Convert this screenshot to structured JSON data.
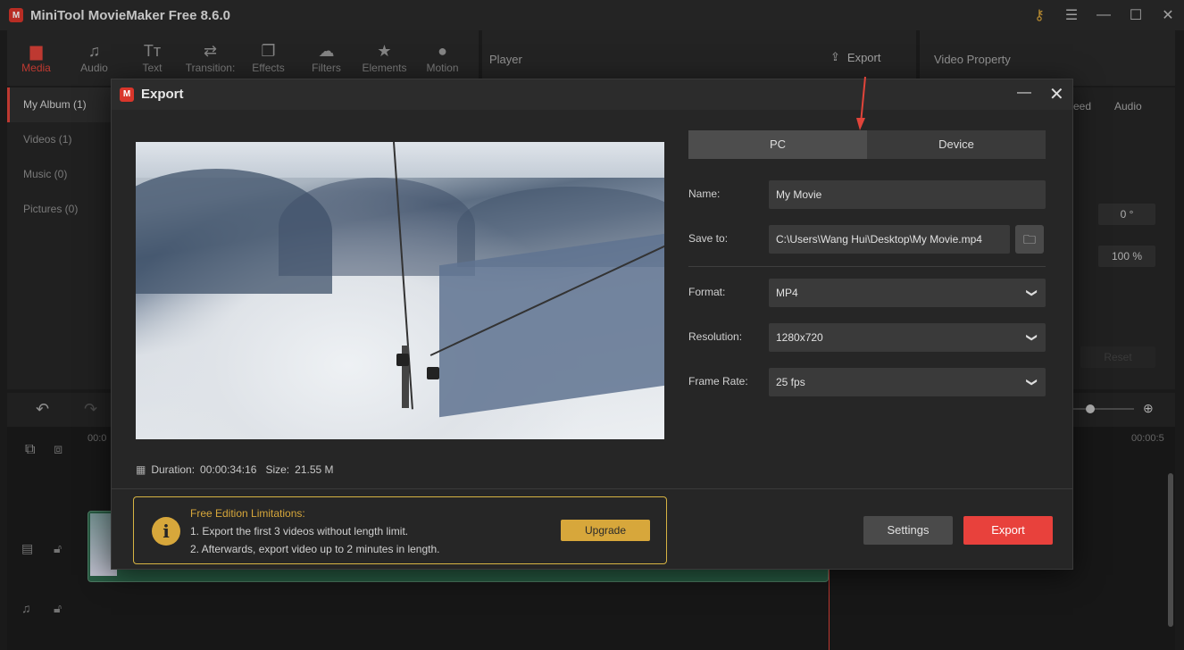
{
  "app": {
    "title": "MiniTool MovieMaker Free 8.6.0"
  },
  "toolbar": {
    "items": [
      {
        "label": "Media"
      },
      {
        "label": "Audio"
      },
      {
        "label": "Text"
      },
      {
        "label": "Transition:"
      },
      {
        "label": "Effects"
      },
      {
        "label": "Filters"
      },
      {
        "label": "Elements"
      },
      {
        "label": "Motion"
      }
    ]
  },
  "player": {
    "label": "Player",
    "export_label": "Export"
  },
  "property": {
    "label": "Video Property",
    "tab_speed": "eed",
    "tab_audio": "Audio",
    "rotation": "0 °",
    "scale": "100 %",
    "reset": "Reset"
  },
  "album": {
    "items": [
      {
        "label": "My Album (1)"
      },
      {
        "label": "Videos (1)"
      },
      {
        "label": "Music (0)"
      },
      {
        "label": "Pictures (0)"
      }
    ]
  },
  "timeline": {
    "start_time": "00:0",
    "end_time": "00:00:5"
  },
  "export_dialog": {
    "title": "Export",
    "duration_label": "Duration:",
    "duration": "00:00:34:16",
    "size_label": "Size:",
    "size": "21.55 M",
    "tabs": [
      {
        "label": "PC"
      },
      {
        "label": "Device"
      }
    ],
    "name_label": "Name:",
    "name_value": "My Movie",
    "saveto_label": "Save to:",
    "saveto_value": "C:\\Users\\Wang Hui\\Desktop\\My Movie.mp4",
    "format_label": "Format:",
    "format_value": "MP4",
    "resolution_label": "Resolution:",
    "resolution_value": "1280x720",
    "framerate_label": "Frame Rate:",
    "framerate_value": "25 fps",
    "limits_title": "Free Edition Limitations:",
    "limits_line1": "1. Export the first 3 videos without length limit.",
    "limits_line2": "2. Afterwards, export video up to 2 minutes in length.",
    "upgrade_label": "Upgrade",
    "settings_label": "Settings",
    "export_label": "Export"
  },
  "colors": {
    "accent": "#e8413c",
    "warning": "#d7a73b"
  }
}
